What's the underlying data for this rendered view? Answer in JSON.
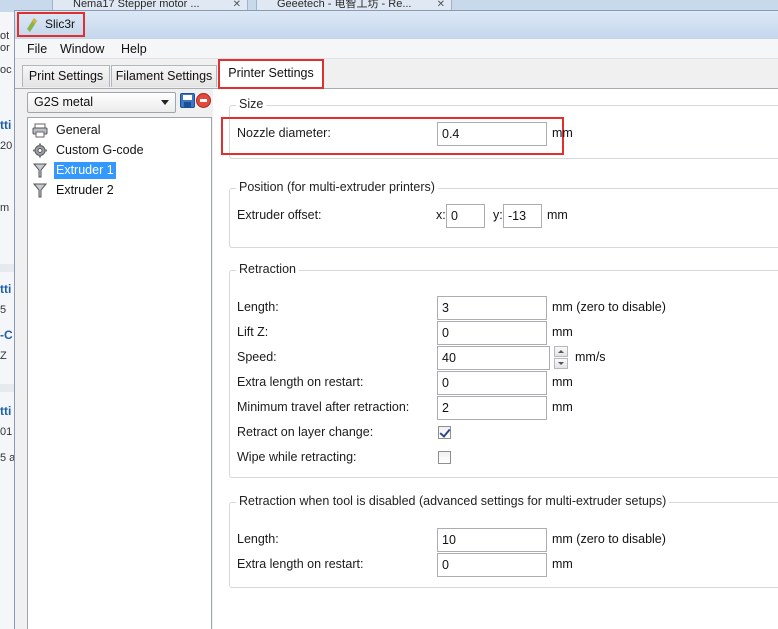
{
  "background": {
    "tabs": [
      {
        "label": "Nema17 Stepper motor ..."
      },
      {
        "label": "Geeetech - 电智工坊 - Re..."
      }
    ],
    "left_fragments": [
      "ot",
      "or",
      "oc",
      "tti",
      "20",
      "m",
      "tti",
      "5",
      "-C",
      "Z",
      "tti",
      "01",
      "5 a"
    ]
  },
  "window": {
    "title": "Slic3r",
    "menu": [
      "File",
      "Window",
      "Help"
    ],
    "tabs": [
      {
        "label": "Print Settings",
        "active": false
      },
      {
        "label": "Filament Settings",
        "active": false
      },
      {
        "label": "Printer Settings",
        "active": true
      }
    ]
  },
  "left_pane": {
    "preset": "G2S metal",
    "tree": [
      {
        "label": "General",
        "icon": "printer-icon",
        "selected": false
      },
      {
        "label": "Custom G-code",
        "icon": "gear-icon",
        "selected": false
      },
      {
        "label": "Extruder 1",
        "icon": "funnel-icon",
        "selected": true
      },
      {
        "label": "Extruder 2",
        "icon": "funnel-icon",
        "selected": false
      }
    ]
  },
  "settings": {
    "size": {
      "title": "Size",
      "nozzle_label": "Nozzle diameter:",
      "nozzle_value": "0.4",
      "nozzle_unit": "mm"
    },
    "position": {
      "title": "Position (for multi-extruder printers)",
      "offset_label": "Extruder offset:",
      "x_label": "x:",
      "x_value": "0",
      "y_label": "y:",
      "y_value": "-13",
      "unit": "mm"
    },
    "retraction": {
      "title": "Retraction",
      "length_label": "Length:",
      "length_value": "3",
      "length_unit": "mm (zero to disable)",
      "liftz_label": "Lift Z:",
      "liftz_value": "0",
      "liftz_unit": "mm",
      "speed_label": "Speed:",
      "speed_value": "40",
      "speed_unit": "mm/s",
      "extra_label": "Extra length on restart:",
      "extra_value": "0",
      "extra_unit": "mm",
      "mintravel_label": "Minimum travel after retraction:",
      "mintravel_value": "2",
      "mintravel_unit": "mm",
      "layerchange_label": "Retract on layer change:",
      "layerchange_checked": true,
      "wipe_label": "Wipe while retracting:",
      "wipe_checked": false
    },
    "retraction_disabled": {
      "title": "Retraction when tool is disabled (advanced settings for multi-extruder setups)",
      "length_label": "Length:",
      "length_value": "10",
      "length_unit": "mm (zero to disable)",
      "extra_label": "Extra length on restart:",
      "extra_value": "0",
      "extra_unit": "mm"
    }
  },
  "colors": {
    "highlight": "#e0302e",
    "selection": "#3399ff"
  }
}
